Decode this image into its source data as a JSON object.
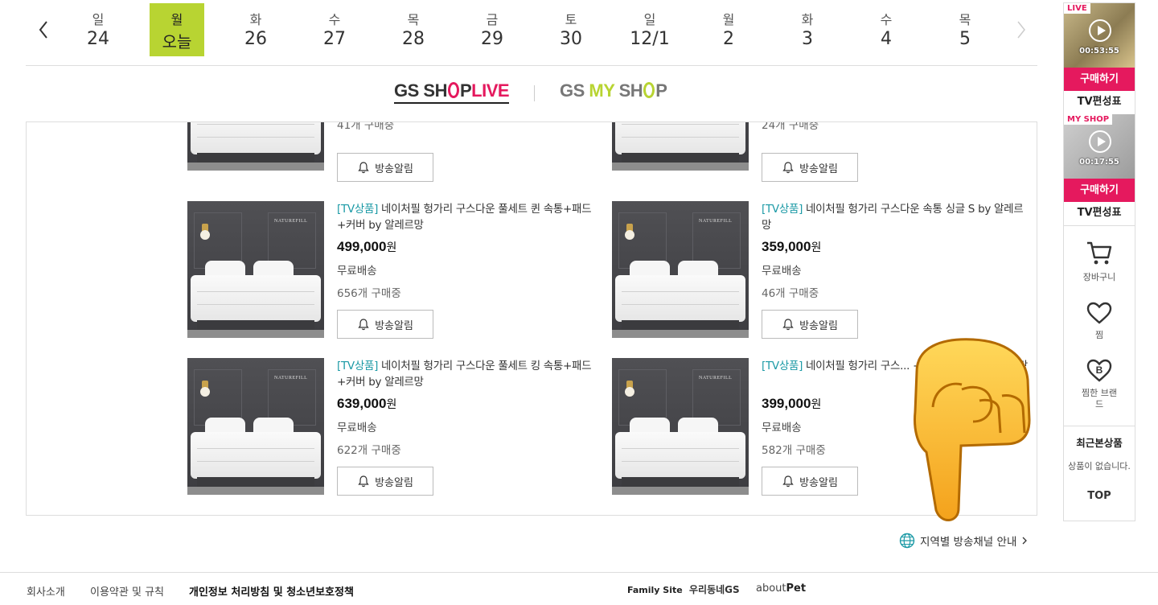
{
  "date_strip": {
    "days": [
      {
        "dow": "일",
        "num": "24"
      },
      {
        "dow": "월",
        "num": "오늘"
      },
      {
        "dow": "화",
        "num": "26"
      },
      {
        "dow": "수",
        "num": "27"
      },
      {
        "dow": "목",
        "num": "28"
      },
      {
        "dow": "금",
        "num": "29"
      },
      {
        "dow": "토",
        "num": "30"
      },
      {
        "dow": "일",
        "num": "12/1"
      },
      {
        "dow": "월",
        "num": "2"
      },
      {
        "dow": "화",
        "num": "3"
      },
      {
        "dow": "수",
        "num": "4"
      },
      {
        "dow": "목",
        "num": "5"
      }
    ],
    "today_color": "#b8d432"
  },
  "channels": {
    "live": {
      "part1": "GS SH",
      "part2": "P",
      "part3": "LIVE"
    },
    "my": {
      "part1": "GS ",
      "part2": "MY",
      "part3": " SH",
      "part4": "P"
    }
  },
  "products": [
    {
      "tag": "",
      "title": "",
      "price": "",
      "won": "",
      "shipping": "",
      "count": "41개 구매중",
      "alarm": "방송알림"
    },
    {
      "tag": "",
      "title": "",
      "price": "",
      "won": "",
      "shipping": "",
      "count": "24개 구매중",
      "alarm": "방송알림"
    },
    {
      "tag": "[TV상품]",
      "title": " 네이처필 헝가리 구스다운 풀세트 퀸 속통+패드+커버 by 알레르망",
      "price": "499,000",
      "won": "원",
      "shipping": "무료배송",
      "count": "656개 구매중",
      "alarm": "방송알림"
    },
    {
      "tag": "[TV상품]",
      "title": " 네이처필 헝가리 구스다운 속통 싱글 S by 알레르망",
      "price": "359,000",
      "won": "원",
      "shipping": "무료배송",
      "count": "46개 구매중",
      "alarm": "방송알림"
    },
    {
      "tag": "[TV상품]",
      "title": " 네이처필 헝가리 구스다운 풀세트 킹 속통+패드+커버 by 알레르망",
      "price": "639,000",
      "won": "원",
      "shipping": "무료배송",
      "count": "622개 구매중",
      "alarm": "방송알림"
    },
    {
      "tag": "[TV상품]",
      "title": " 네이처필 헝가리 구스... +패드+커버 by 알레르망",
      "price": "399,000",
      "won": "원",
      "shipping": "무료배송",
      "count": "582개 구매중",
      "alarm": "방송알림"
    }
  ],
  "thumb_logo": "NATUREFILL",
  "region_link": "지역별 방송채널 안내",
  "footer": {
    "links": [
      "회사소개",
      "이용약관 및 규칙",
      "개인정보 처리방침 및 청소년보호정책"
    ],
    "family_site": "Family Site",
    "family_logo1": "우리동네GS",
    "family_logo2_a": "about",
    "family_logo2_b": "Pet"
  },
  "sidebar": {
    "live_badge": "LIVE",
    "live_time": "00:53:55",
    "my_badge": "MY SHOP",
    "my_time": "00:17:55",
    "buy": "구매하기",
    "schedule": "TV편성표",
    "cart": "장바구니",
    "wish": "찜",
    "wish_brand": "찜한 브랜드",
    "recent_title": "최근본상품",
    "recent_empty": "상품이 없습니다.",
    "top": "TOP"
  },
  "colors": {
    "accent": "#e5195e",
    "lime": "#b8d432",
    "tag": "#1c9aa6"
  }
}
